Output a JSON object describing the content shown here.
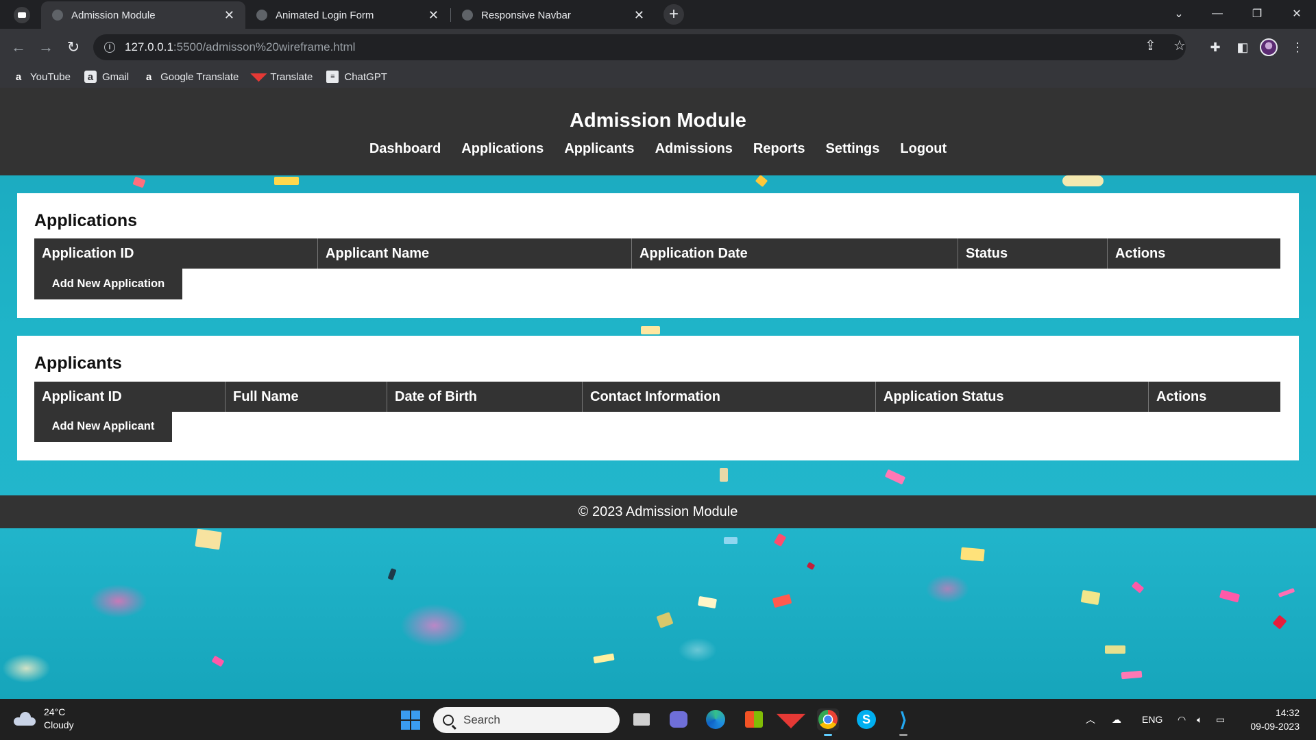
{
  "browser": {
    "tabs": [
      {
        "title": "Admission Module",
        "active": true
      },
      {
        "title": "Animated Login Form",
        "active": false
      },
      {
        "title": "Responsive Navbar",
        "active": false
      }
    ],
    "url_host": "127.0.0.1",
    "url_path": ":5500/admisson%20wireframe.html",
    "bookmarks": [
      {
        "label": "YouTube",
        "icon": "amazon-a-icon"
      },
      {
        "label": "Gmail",
        "icon": "amazon-box-icon"
      },
      {
        "label": "Google Translate",
        "icon": "amazon-a-icon"
      },
      {
        "label": "Translate",
        "icon": "mcafee-icon"
      },
      {
        "label": "ChatGPT",
        "icon": "document-icon"
      }
    ]
  },
  "site": {
    "title": "Admission Module",
    "nav": [
      "Dashboard",
      "Applications",
      "Applicants",
      "Admissions",
      "Reports",
      "Settings",
      "Logout"
    ],
    "applications": {
      "heading": "Applications",
      "columns": [
        "Application ID",
        "Applicant Name",
        "Application Date",
        "Status",
        "Actions"
      ],
      "add_button": "Add New Application"
    },
    "applicants": {
      "heading": "Applicants",
      "columns": [
        "Applicant ID",
        "Full Name",
        "Date of Birth",
        "Contact Information",
        "Application Status",
        "Actions"
      ],
      "add_button": "Add New Applicant"
    },
    "footer": "© 2023 Admission Module"
  },
  "taskbar": {
    "weather_temp": "24°C",
    "weather_desc": "Cloudy",
    "search_placeholder": "Search",
    "language": "ENG",
    "time": "14:32",
    "date": "09-09-2023"
  },
  "colors": {
    "header_bg": "#333333",
    "page_bg": "#1fb4c8",
    "card_bg": "#ffffff"
  }
}
